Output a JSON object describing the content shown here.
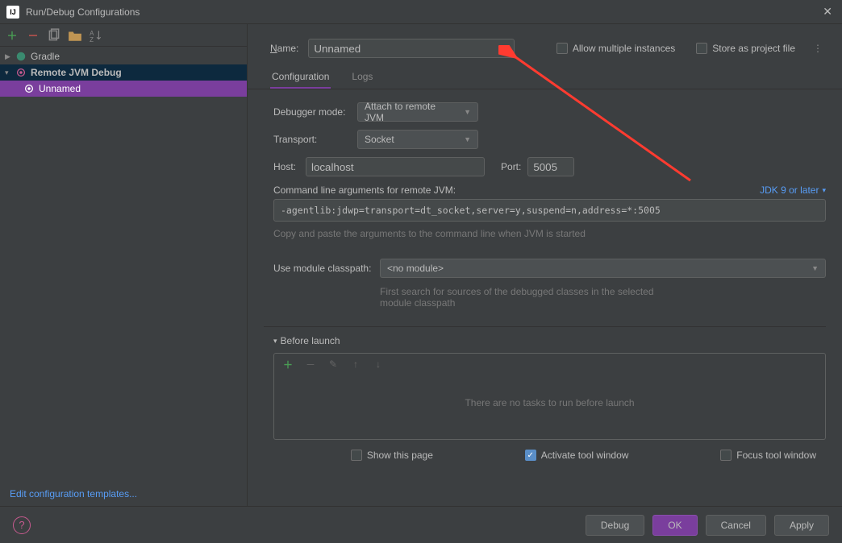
{
  "window": {
    "title": "Run/Debug Configurations"
  },
  "sidebar": {
    "items": [
      {
        "label": "Gradle",
        "expanded": false,
        "type": "gradle"
      },
      {
        "label": "Remote JVM Debug",
        "expanded": true,
        "type": "remote"
      }
    ],
    "children": [
      {
        "label": "Unnamed",
        "selected": true
      }
    ],
    "edit_templates": "Edit configuration templates..."
  },
  "header": {
    "name_label": "Name:",
    "name_value": "Unnamed",
    "allow_multi": "Allow multiple instances",
    "store_as": "Store as project file"
  },
  "tabs": {
    "config": "Configuration",
    "logs": "Logs"
  },
  "form": {
    "debugger_mode_label": "Debugger mode:",
    "debugger_mode_value": "Attach to remote JVM",
    "transport_label": "Transport:",
    "transport_value": "Socket",
    "host_label": "Host:",
    "host_value": "localhost",
    "port_label": "Port:",
    "port_value": "5005",
    "cmd_label": "Command line arguments for remote JVM:",
    "jdk_link": "JDK 9 or later",
    "cmd_value": "-agentlib:jdwp=transport=dt_socket,server=y,suspend=n,address=*:5005",
    "cmd_hint": "Copy and paste the arguments to the command line when JVM is started",
    "module_label": "Use module classpath:",
    "module_value": "<no module>",
    "module_hint": "First search for sources of the debugged classes in the selected module classpath"
  },
  "before_launch": {
    "label": "Before launch",
    "empty": "There are no tasks to run before launch"
  },
  "footer": {
    "show_page": "Show this page",
    "activate": "Activate tool window",
    "focus": "Focus tool window"
  },
  "buttons": {
    "debug": "Debug",
    "ok": "OK",
    "cancel": "Cancel",
    "apply": "Apply"
  }
}
